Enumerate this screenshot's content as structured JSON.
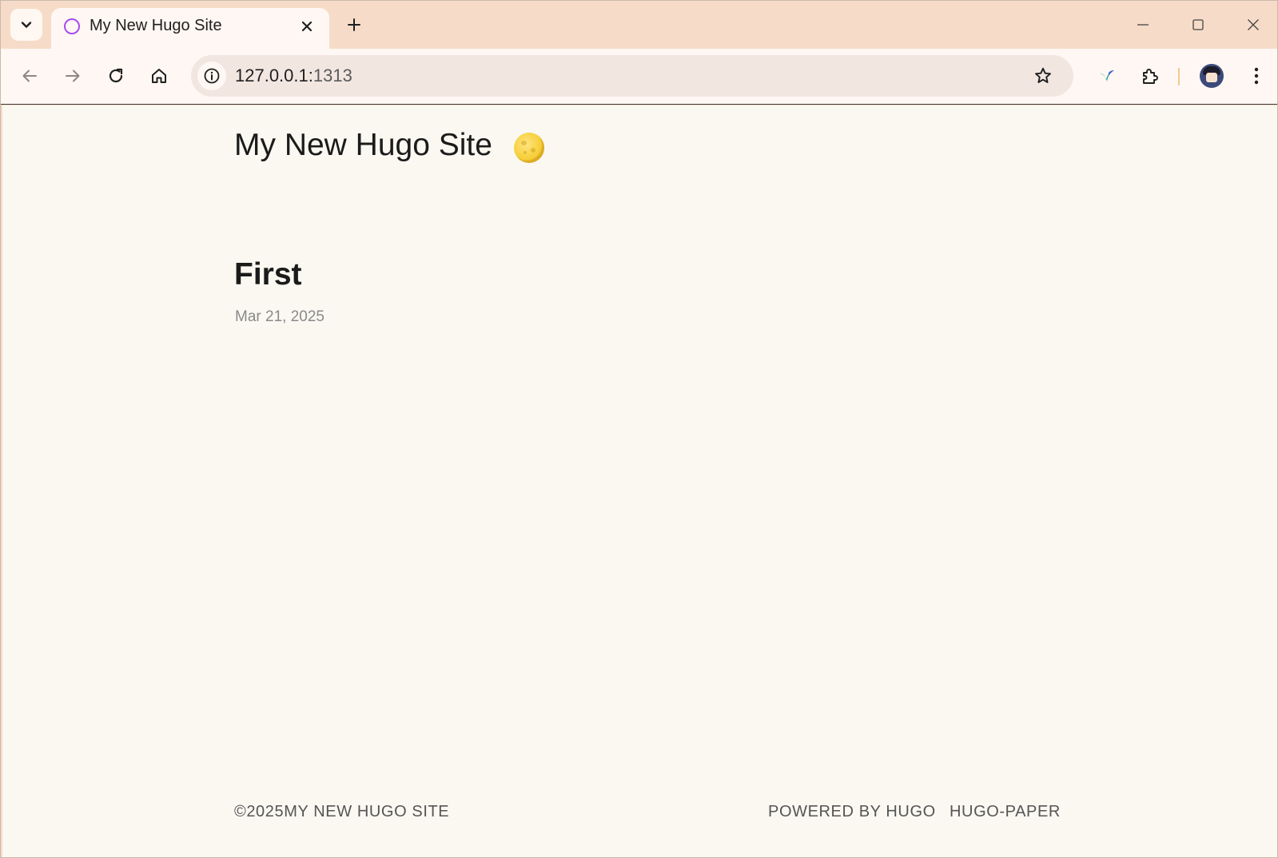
{
  "browser": {
    "tab": {
      "title": "My New Hugo Site"
    },
    "address_bar": {
      "host": "127.0.0.1:",
      "port": "1313"
    }
  },
  "page": {
    "site_title": "My New Hugo Site",
    "posts": [
      {
        "title": "First",
        "date": "Mar 21, 2025"
      }
    ],
    "footer": {
      "copyright": "©2025MY NEW HUGO SITE",
      "links": [
        "POWERED BY HUGO",
        "HUGO-PAPER"
      ]
    }
  },
  "colors": {
    "tab_strip": "#f6dcc8",
    "toolbar": "#fff7f3",
    "page_background": "#faf8f1",
    "favicon_ring": "#a64cf0"
  },
  "icons": {
    "tab_search": "chevron-down-icon",
    "favicon": "ring-icon",
    "tab_close": "close-icon",
    "new_tab": "plus-icon",
    "minimize": "minimize-icon",
    "maximize": "maximize-icon",
    "close_window": "close-icon",
    "back": "arrow-left-icon",
    "forward": "arrow-right-icon",
    "reload": "reload-icon",
    "home": "home-icon",
    "site_info": "info-icon",
    "bookmark": "star-icon",
    "extension_bird": "bird-icon",
    "extensions": "puzzle-icon",
    "profile": "avatar",
    "menu": "kebab-menu-icon",
    "theme_toggle": "moon-icon"
  }
}
